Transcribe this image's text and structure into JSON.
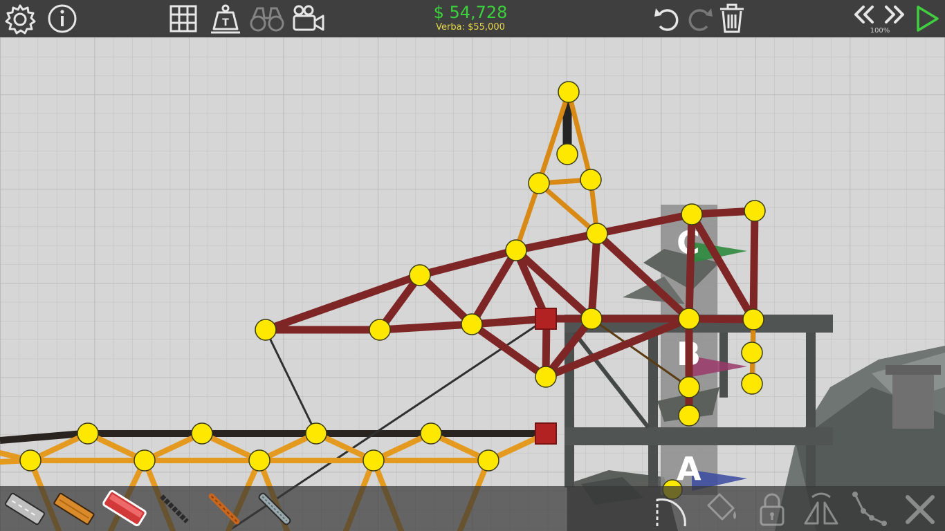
{
  "toolbar": {
    "settings_icon": "gear-icon",
    "info_icon": "info-icon",
    "grid_icon": "grid-icon",
    "weight_icon": "weight-icon",
    "weight_label": "T",
    "binoculars_icon": "binoculars-icon",
    "camera_icon": "video-camera-icon",
    "undo_icon": "undo-icon",
    "redo_icon": "redo-icon",
    "trash_icon": "trash-icon",
    "rewind_icon": "rewind-icon",
    "fast_forward_icon": "fast-forward-icon",
    "play_icon": "play-icon",
    "speed": "100%"
  },
  "budget": {
    "cost": "$ 54,728",
    "budget_label": "Verba: $55,000"
  },
  "checkpoints": {
    "a": "A",
    "b": "B",
    "c": "C"
  },
  "materials": [
    {
      "name": "road",
      "icon": "road-icon"
    },
    {
      "name": "wood",
      "icon": "wood-beam-icon"
    },
    {
      "name": "reinforced-road",
      "icon": "reinforced-road-icon",
      "selected": true
    },
    {
      "name": "rope",
      "icon": "rope-icon"
    },
    {
      "name": "cable",
      "icon": "cable-icon"
    },
    {
      "name": "steel",
      "icon": "steel-icon"
    }
  ],
  "tools": {
    "arc_icon": "arc-tool-icon",
    "paint_icon": "paint-bucket-icon",
    "lock_icon": "lock-icon",
    "mirror_icon": "mirror-icon",
    "split_icon": "split-icon",
    "close_icon": "close-icon"
  },
  "colors": {
    "topbar": "#3f3f3f",
    "money": "#3bd23b",
    "budget": "#e8d94a",
    "joint": "#ffe800",
    "wood": "#e39a1e",
    "road": "#8a2a2a",
    "anchor": "#b22222",
    "play": "#3fcf3f"
  }
}
